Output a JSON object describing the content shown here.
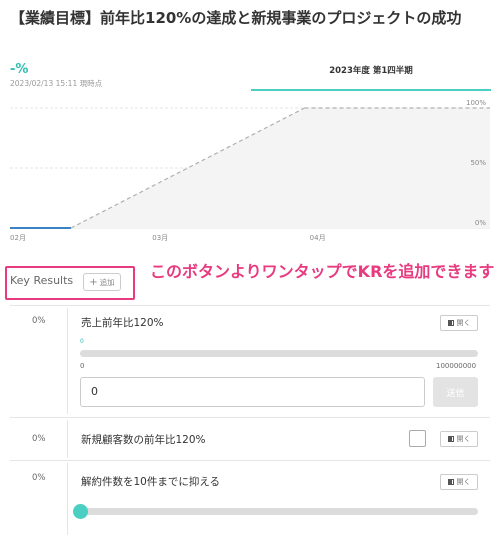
{
  "objective": {
    "title": "【業績目標】前年比120%の達成と新規事業のプロジェクトの成功",
    "progress_value": "-%",
    "timestamp": "2023/02/13 15:11 現時点",
    "quarter_tab": "2023年度 第1四半期"
  },
  "chart_data": {
    "type": "line",
    "x_ticks": [
      "02月",
      "03月",
      "04月"
    ],
    "y_ticks": [
      "0%",
      "50%",
      "100%"
    ],
    "ylim": [
      0,
      100
    ],
    "series": [
      {
        "role": "actual",
        "style": "solid",
        "color": "#3b82c4",
        "x": [
          "02/01",
          "02/13"
        ],
        "y": [
          0,
          0
        ]
      },
      {
        "role": "target",
        "style": "dashed",
        "color": "#b0b0b0",
        "x": [
          "02/13",
          "03/31"
        ],
        "y": [
          0,
          100
        ]
      }
    ]
  },
  "key_results": {
    "header_label": "Key Results",
    "add_button_label": "追加",
    "add_button_icon": "plus-icon",
    "annotation": "このボタンよりワンタップでKRを追加できます",
    "highlight_color": "#e83b7f",
    "items": [
      {
        "percent": "0%",
        "name": "売上前年比120%",
        "toggle_label": "開く",
        "progress_current": "0",
        "progress_fraction": 0,
        "range_min": "0",
        "range_max": "100000000",
        "input_value": "0",
        "submit_label": "送信"
      },
      {
        "percent": "0%",
        "name": "新規顧客数の前年比120%",
        "toggle_label": "開く",
        "checked": false
      },
      {
        "percent": "0%",
        "name": "解約件数を10件までに抑える",
        "toggle_label": "開く",
        "progress_fraction": 0
      }
    ]
  },
  "colors": {
    "accent": "#4ccfc3",
    "accent_text": "#2fbfb0",
    "submit_disabled": "#e3e3e3"
  }
}
